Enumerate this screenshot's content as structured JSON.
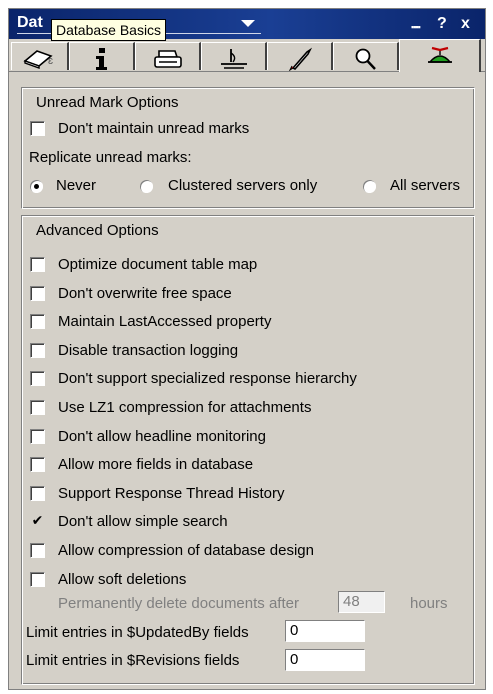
{
  "window": {
    "title": "Database Basics",
    "title_visible": "Dat",
    "tooltip": "Database Basics",
    "controls": {
      "menu_glyph": "▪▪▪▪",
      "help": "?",
      "close": "x"
    }
  },
  "tabs": [
    {
      "name": "basics-tab",
      "icon": "database-icon"
    },
    {
      "name": "info-tab",
      "icon": "info-icon"
    },
    {
      "name": "print-tab",
      "icon": "printer-icon"
    },
    {
      "name": "design-tab",
      "icon": "design-icon"
    },
    {
      "name": "launch-tab",
      "icon": "rocket-icon"
    },
    {
      "name": "full-text-tab",
      "icon": "magnifier-icon"
    },
    {
      "name": "advanced-tab",
      "icon": "propeller-hat-icon",
      "active": true
    }
  ],
  "unread": {
    "title": "Unread Mark Options",
    "dont_maintain": {
      "label": "Don't maintain unread marks",
      "checked": false
    },
    "replicate_label": "Replicate unread marks:",
    "options": [
      {
        "label": "Never",
        "checked": true
      },
      {
        "label": "Clustered servers only",
        "checked": false
      },
      {
        "label": "All servers",
        "checked": false
      }
    ]
  },
  "advanced": {
    "title": "Advanced Options",
    "items": [
      {
        "label": "Optimize document table map",
        "checked": false
      },
      {
        "label": "Don't overwrite free space",
        "checked": false
      },
      {
        "label": "Maintain LastAccessed property",
        "checked": false
      },
      {
        "label": "Disable transaction logging",
        "checked": false
      },
      {
        "label": "Don't support specialized response hierarchy",
        "checked": false
      },
      {
        "label": "Use LZ1 compression for attachments",
        "checked": false
      },
      {
        "label": "Don't allow headline monitoring",
        "checked": false
      },
      {
        "label": "Allow more fields in database",
        "checked": false
      },
      {
        "label": "Support Response Thread History",
        "checked": false
      },
      {
        "label": "Don't allow simple search",
        "checked": true,
        "mark": "✔"
      },
      {
        "label": "Allow compression of database design",
        "checked": false
      },
      {
        "label": "Allow soft deletions",
        "checked": false
      }
    ],
    "permanent_delete": {
      "label": "Permanently delete documents after",
      "value": "48",
      "unit": "hours"
    },
    "updated_by": {
      "label": "Limit entries in $UpdatedBy fields",
      "value": "0"
    },
    "revisions": {
      "label": "Limit entries in $Revisions fields",
      "value": "0"
    }
  }
}
